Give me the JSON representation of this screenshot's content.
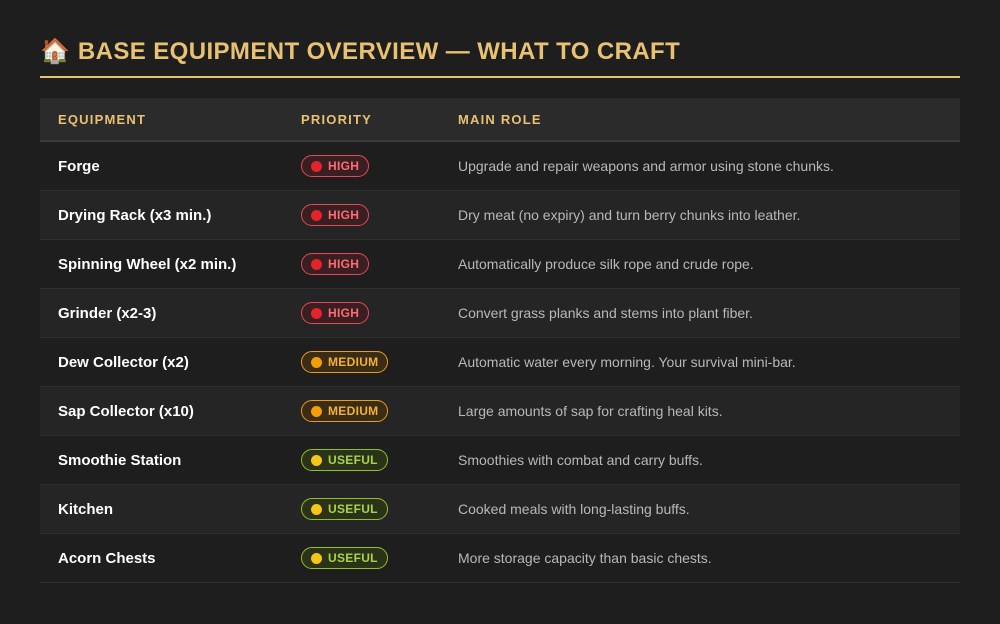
{
  "header": {
    "icon": "house-icon",
    "icon_glyph": "🏠",
    "title": "BASE EQUIPMENT OVERVIEW — WHAT TO CRAFT"
  },
  "table": {
    "columns": [
      "EQUIPMENT",
      "PRIORITY",
      "MAIN ROLE"
    ],
    "rows": [
      {
        "equipment": "Forge",
        "priority": "HIGH",
        "level": "high",
        "role": "Upgrade and repair weapons and armor using stone chunks."
      },
      {
        "equipment": "Drying Rack (x3 min.)",
        "priority": "HIGH",
        "level": "high",
        "role": "Dry meat (no expiry) and turn berry chunks into leather."
      },
      {
        "equipment": "Spinning Wheel (x2 min.)",
        "priority": "HIGH",
        "level": "high",
        "role": "Automatically produce silk rope and crude rope."
      },
      {
        "equipment": "Grinder (x2-3)",
        "priority": "HIGH",
        "level": "high",
        "role": "Convert grass planks and stems into plant fiber."
      },
      {
        "equipment": "Dew Collector (x2)",
        "priority": "MEDIUM",
        "level": "medium",
        "role": "Automatic water every morning. Your survival mini-bar."
      },
      {
        "equipment": "Sap Collector (x10)",
        "priority": "MEDIUM",
        "level": "medium",
        "role": "Large amounts of sap for crafting heal kits."
      },
      {
        "equipment": "Smoothie Station",
        "priority": "USEFUL",
        "level": "useful",
        "role": "Smoothies with combat and carry buffs."
      },
      {
        "equipment": "Kitchen",
        "priority": "USEFUL",
        "level": "useful",
        "role": "Cooked meals with long-lasting buffs."
      },
      {
        "equipment": "Acorn Chests",
        "priority": "USEFUL",
        "level": "useful",
        "role": "More storage capacity than basic chests."
      }
    ]
  },
  "colors": {
    "accent": "#e8c172",
    "high": "#e3242b",
    "medium": "#f59c0b",
    "useful": "#8fbf2a"
  }
}
